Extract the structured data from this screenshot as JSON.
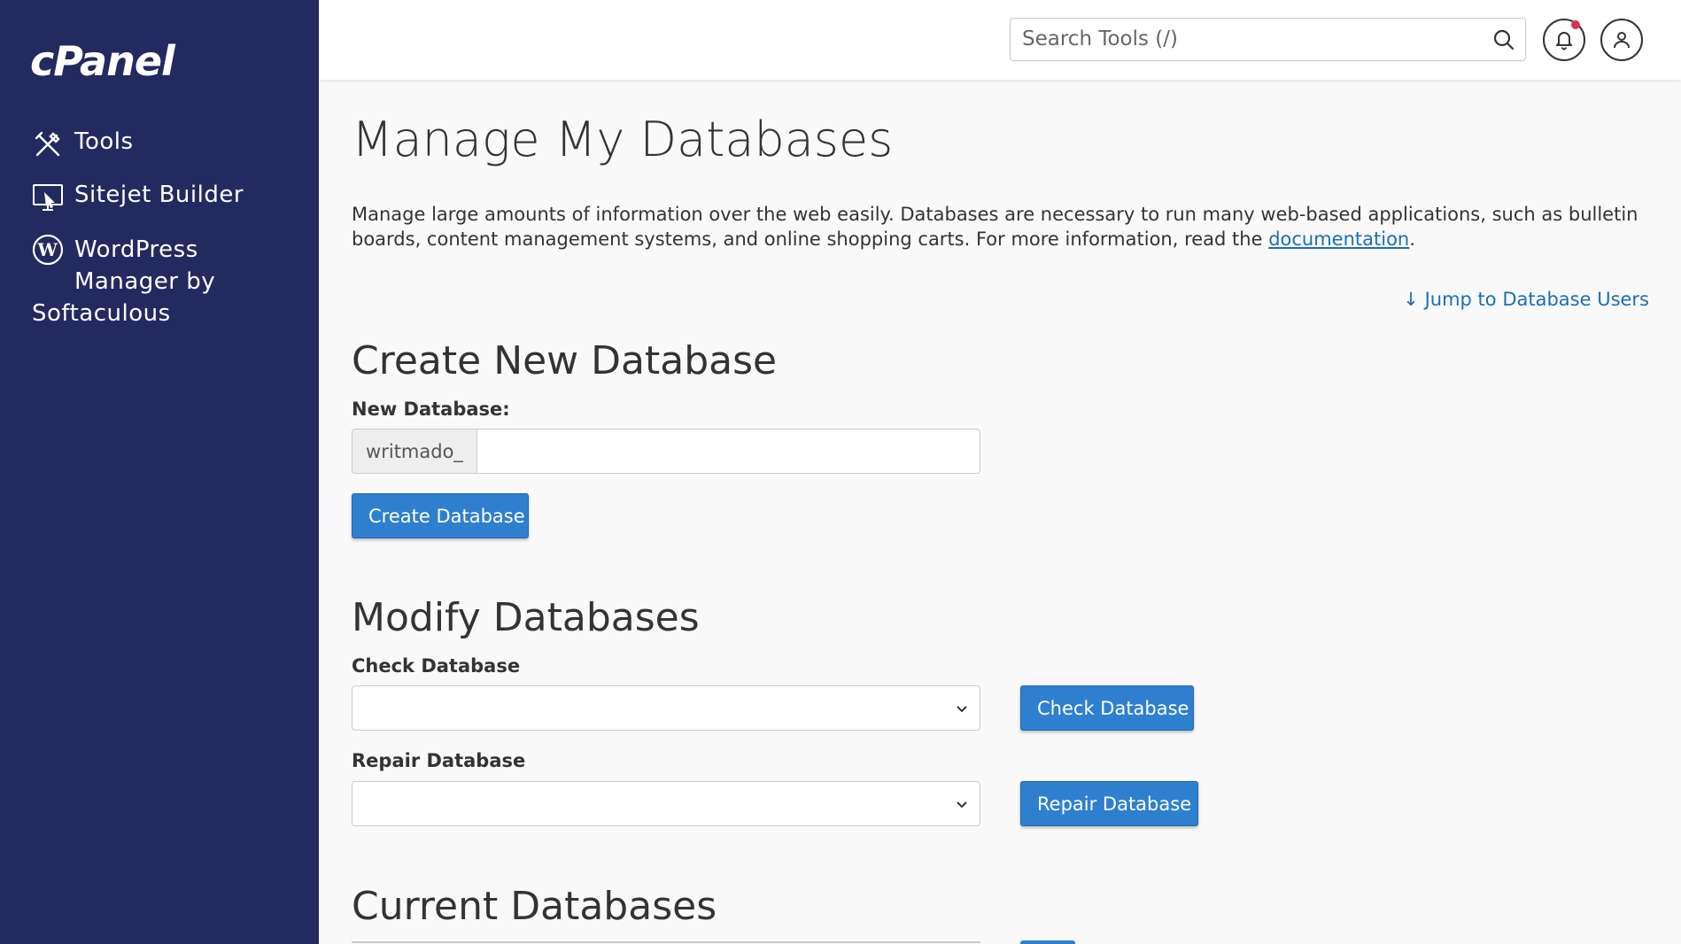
{
  "sidebar": {
    "logo": "cPanel",
    "items": [
      {
        "label": "Tools",
        "icon": "tools-icon"
      },
      {
        "label": "Sitejet Builder",
        "icon": "sitejet-icon"
      },
      {
        "label_line1": "WordPress",
        "label_line2": "Manager by",
        "label_line3": "Softaculous",
        "icon": "wordpress-icon"
      }
    ]
  },
  "header": {
    "search_placeholder": "Search Tools (/)",
    "search_icon": "search-icon",
    "notifications_icon": "bell-icon",
    "user_icon": "user-icon",
    "notification_dot_color": "#d9334c"
  },
  "main": {
    "title": "Manage My Databases",
    "description": "Manage large amounts of information over the web easily. Databases are necessary to run many web-based applications, such as bulletin boards, content management systems, and online shopping carts. For more information, read the ",
    "documentation_link": "documentation",
    "description_end": ".",
    "jump_link": "Jump to Database Users",
    "create": {
      "heading": "Create New Database",
      "label": "New Database:",
      "prefix": "writmado_",
      "value": "",
      "button": "Create Database"
    },
    "modify": {
      "heading": "Modify Databases",
      "check_label": "Check Database",
      "check_selected": "",
      "check_button": "Check Database",
      "repair_label": "Repair Database",
      "repair_selected": "",
      "repair_button": "Repair Database"
    },
    "current": {
      "heading": "Current Databases"
    }
  },
  "colors": {
    "sidebar_bg": "#232a5f",
    "primary_button": "#2f7fcf",
    "link": "#1a6fb5"
  }
}
